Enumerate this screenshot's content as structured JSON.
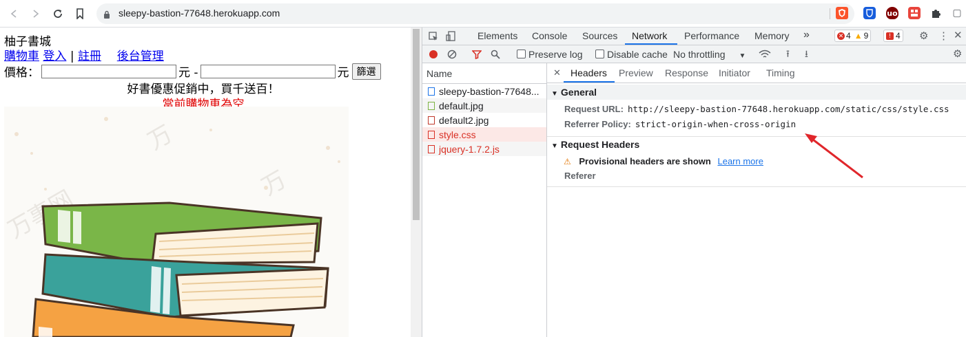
{
  "browser": {
    "url": "sleepy-bastion-77648.herokuapp.com",
    "icons": [
      "back-icon",
      "forward-icon",
      "reload-icon",
      "bookmark-icon",
      "lock-icon"
    ],
    "extensions": [
      "brave-shield-icon",
      "bitwarden-icon",
      "ublock-icon",
      "extension-red-icon",
      "extensions-puzzle-icon",
      "profile-icon"
    ]
  },
  "page": {
    "store_title": "柚子書城",
    "links": [
      "購物車",
      "登入",
      "|",
      "註冊",
      "後台管理"
    ],
    "price_label": "價格：",
    "price_unit_dash": "元 -",
    "price_unit": "元",
    "filter_button": "篩選",
    "promo": "好書優惠促銷中，買千送百！",
    "cart_status": "當前購物車為空",
    "image_watermark": "万事网"
  },
  "devtools": {
    "tabs": [
      "Elements",
      "Console",
      "Sources",
      "Network",
      "Performance",
      "Memory"
    ],
    "active_tab": "Network",
    "more_tabs": "»",
    "errors": "4",
    "warnings": "9",
    "issues": "4",
    "network_toolbar": {
      "preserve_log": "Preserve log",
      "disable_cache": "Disable cache",
      "throttling": "No throttling"
    },
    "requests_header": "Name",
    "requests": [
      {
        "name": "sleepy-bastion-77648...",
        "status": "ok"
      },
      {
        "name": "default.jpg",
        "status": "ok"
      },
      {
        "name": "default2.jpg",
        "status": "ok"
      },
      {
        "name": "style.css",
        "status": "error"
      },
      {
        "name": "jquery-1.7.2.js",
        "status": "error"
      }
    ],
    "detail_tabs": [
      "Headers",
      "Preview",
      "Response",
      "Initiator",
      "Timing"
    ],
    "active_detail_tab": "Headers",
    "general": {
      "title": "General",
      "request_url_label": "Request URL:",
      "request_url": "http://sleepy-bastion-77648.herokuapp.com/static/css/style.css",
      "referrer_policy_label": "Referrer Policy:",
      "referrer_policy": "strict-origin-when-cross-origin"
    },
    "request_headers": {
      "title": "Request Headers",
      "warning": "Provisional headers are shown",
      "learn_more": "Learn more",
      "referer": "Referer"
    }
  },
  "colors": {
    "link": "#0000ee",
    "cart_status": "#e00000",
    "accent": "#1a73e8",
    "error": "#d93025",
    "annotation_arrow": "#e0262b"
  }
}
